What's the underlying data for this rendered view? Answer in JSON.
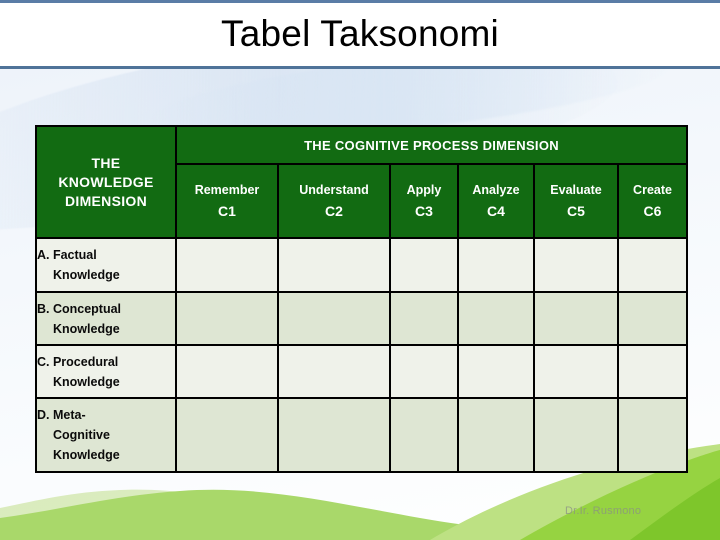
{
  "slide": {
    "title": "Tabel Taksonomi",
    "watermark": "Dr.Ir. Rusmono"
  },
  "colors": {
    "header_green": "#126b12",
    "header_text": "#ffffff",
    "rule_blue": "#4f7399",
    "row_light": "#eff2ea",
    "row_dark": "#dee6d3",
    "hill_green_light": "#b5de7a",
    "hill_green_mid": "#9ad34e",
    "hill_green_dark": "#7cc62f",
    "watermark_gray": "#8a8f86"
  },
  "table": {
    "corner_header": {
      "line1": "THE",
      "line2": "KNOWLEDGE",
      "line3": "DIMENSION"
    },
    "span_header": "THE COGNITIVE PROCESS DIMENSION",
    "columns": [
      {
        "name": "Remember",
        "code": "C1"
      },
      {
        "name": "Understand",
        "code": "C2"
      },
      {
        "name": "Apply",
        "code": "C3"
      },
      {
        "name": "Analyze",
        "code": "C4"
      },
      {
        "name": "Evaluate",
        "code": "C5"
      },
      {
        "name": "Create",
        "code": "C6"
      }
    ],
    "rows": [
      {
        "line1": "A. Factual",
        "line2": "Knowledge",
        "line3": ""
      },
      {
        "line1": "B. Conceptual",
        "line2": "Knowledge",
        "line3": ""
      },
      {
        "line1": "C. Procedural",
        "line2": "Knowledge",
        "line3": ""
      },
      {
        "line1": "D. Meta-",
        "line2": "Cognitive",
        "line3": "Knowledge"
      }
    ]
  }
}
